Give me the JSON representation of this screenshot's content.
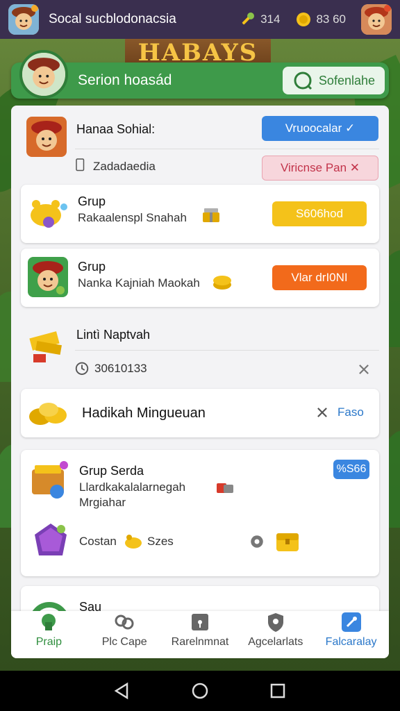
{
  "topbar": {
    "app_title": "Socal sucblodonacsia",
    "stat1_value": "314",
    "stat2_value": "83 60"
  },
  "banner": {
    "title": "Serion hoasád",
    "button_label": "Sofenlahe"
  },
  "cards": {
    "profile": {
      "name": "Hanaa Sohial:",
      "sub": "Zadadaedia",
      "verify_label": "Vruoocalar ✓",
      "report_label": "Viricnse Pan ✕"
    },
    "group1": {
      "title": "Grup",
      "sub": "Rakaalenspl Snahah",
      "button_label": "S606hod"
    },
    "group2": {
      "title": "Grup",
      "sub": "Nanka Kajniah Maokah",
      "button_label": "Vlar drI0NI"
    },
    "limit": {
      "title": "Lintì Naptvah",
      "timer": "30610133"
    },
    "reward": {
      "title": "Hadikah Mingueuan",
      "action_label": "Faso"
    },
    "group3": {
      "title": "Grup Serda",
      "sub1": "Llardkakalalarnegah",
      "sub2": "Mrgiahar",
      "badge": "%S66",
      "row2_label": "Costan",
      "row2_sub": "Szes"
    },
    "partial": {
      "title": "Sau"
    }
  },
  "bottomnav": {
    "items": [
      {
        "label": "Praip"
      },
      {
        "label": "Plc Cape"
      },
      {
        "label": "Rarelnmnat"
      },
      {
        "label": "Agcelarlats"
      },
      {
        "label": "Falcaralay"
      }
    ]
  },
  "colors": {
    "topbar": "#3a2f4f",
    "banner": "#3e9a4a",
    "blue_pill": "#3a86e0",
    "yellow_pill": "#f4c21a",
    "orange_pill": "#f26a1b",
    "pink_pill": "#f7d6dc"
  }
}
